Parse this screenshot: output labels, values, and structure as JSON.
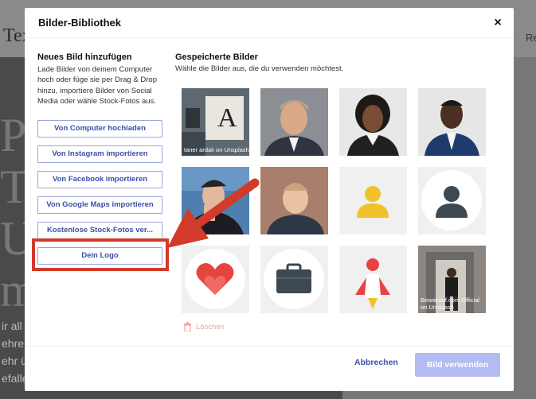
{
  "background": {
    "header_text": "Tex",
    "header_right": "Re",
    "big_letters": [
      "Pr",
      "Te",
      "Ur",
      "m"
    ],
    "small_lines": [
      "ir all",
      "ehre t",
      "ehr ü",
      "efalle"
    ]
  },
  "modal": {
    "title": "Bilder-Bibliothek",
    "close": "×",
    "add_section": {
      "title": "Neues Bild hinzufügen",
      "description": "Lade Bilder von deinem Computer hoch oder füge sie per Drag & Drop hinzu, importiere Bilder von Social Media oder wähle Stock-Fotos aus.",
      "buttons": [
        "Von Computer hochladen",
        "Von Instagram importieren",
        "Von Facebook importieren",
        "Von Google Maps importieren",
        "Kostenlose Stock-Fotos ver...",
        "Dein Logo"
      ]
    },
    "saved_section": {
      "title": "Gespeicherte Bilder",
      "description": "Wähle die Bilder aus, die du verwenden möchtest.",
      "images": [
        {
          "name": "desk-letter-a",
          "credit": "taner ardalı on Unsplash"
        },
        {
          "name": "man-suit-grey"
        },
        {
          "name": "woman-smiling"
        },
        {
          "name": "man-blue-suit"
        },
        {
          "name": "man-glasses-thinking"
        },
        {
          "name": "man-smiling-wall"
        },
        {
          "name": "person-yellow-icon"
        },
        {
          "name": "person-grey-icon"
        },
        {
          "name": "heart-icon"
        },
        {
          "name": "briefcase-icon"
        },
        {
          "name": "rocket-icon"
        },
        {
          "name": "man-doorway",
          "credit": "Bewakoof.com Official on Unsplash"
        }
      ]
    },
    "delete_label": "Löschen",
    "cancel_label": "Abbrechen",
    "use_label": "Bild verwenden"
  },
  "colors": {
    "accent": "#3a4fa8",
    "primary_disabled": "#b3bcf2",
    "annotation_red": "#d23a29",
    "delete_text": "#f3a49a"
  }
}
